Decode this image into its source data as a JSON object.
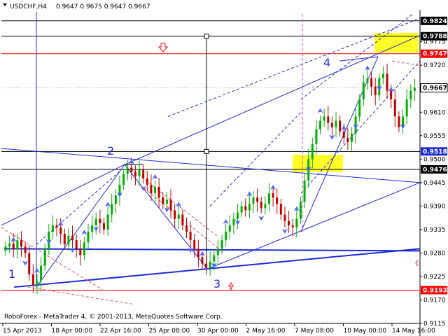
{
  "header": {
    "symbol_timeframe": "USDCHF,H4",
    "ohlc": "0.9647 0.9675 0.9647 0.9667"
  },
  "footer": {
    "copyright": "RoboForex - MetaTrader 4, © 2001-2013, MetaQuotes Software Corp."
  },
  "wave_labels": [
    "1",
    "2",
    "3",
    "4"
  ],
  "colors": {
    "up": "#00b000",
    "down": "#c00000",
    "wave_line": "#1f2bd6",
    "level_red": "#ff0000",
    "level_black": "#000000",
    "target_zone": "#ffff00",
    "fractal": "#4a64ff"
  },
  "chart_data": {
    "type": "candlestick",
    "symbol": "USDCHF",
    "timeframe": "H4",
    "ylim": [
      0.9115,
      0.9845
    ],
    "y_ticks": [
      0.9115,
      0.917,
      0.9225,
      0.928,
      0.9335,
      0.939,
      0.9445,
      0.95,
      0.9555,
      0.961,
      0.9665,
      0.972,
      0.9775
    ],
    "y_tick_labels": [
      "0.9115",
      "0.9170",
      "0.9225",
      "0.9280",
      "0.9335",
      "0.9390",
      "0.9445",
      "0.9500",
      "0.9555",
      "0.9610",
      "0.9665",
      "0.9720",
      "0.9775"
    ],
    "x_tick_labels": [
      "15 Apr 2013",
      "18 Apr 00:00",
      "22 Apr 16:00",
      "25 Apr 08:00",
      "30 Apr 00:00",
      "2 May 16:00",
      "7 May 08:00",
      "10 May 00:00",
      "14 May 16:00"
    ],
    "price_tags": [
      {
        "label": "0.9824",
        "value": 0.9824,
        "style": "black"
      },
      {
        "label": "0.9788",
        "value": 0.9788,
        "style": "black"
      },
      {
        "label": "0.9747",
        "value": 0.9747,
        "style": "red"
      },
      {
        "label": "0.9667",
        "value": 0.9667,
        "style": "current"
      },
      {
        "label": "0.9518",
        "value": 0.9518,
        "style": "blue"
      },
      {
        "label": "0.9476",
        "value": 0.9476,
        "style": "black"
      },
      {
        "label": "0.9193",
        "value": 0.9193,
        "style": "red"
      }
    ],
    "horizontal_levels": [
      {
        "value": 0.9824,
        "color": "#000000"
      },
      {
        "value": 0.9788,
        "color": "#000000"
      },
      {
        "value": 0.9747,
        "color": "#ff0000"
      },
      {
        "value": 0.9667,
        "color": "#999999",
        "dotted": true
      },
      {
        "value": 0.9518,
        "color": "#000000"
      },
      {
        "value": 0.9476,
        "color": "#000000"
      },
      {
        "value": 0.9193,
        "color": "#ff0000"
      }
    ],
    "closes": [
      0.9295,
      0.9302,
      0.9288,
      0.931,
      0.9295,
      0.928,
      0.923,
      0.9205,
      0.9215,
      0.925,
      0.929,
      0.933,
      0.9345,
      0.934,
      0.9325,
      0.93,
      0.932,
      0.931,
      0.929,
      0.9275,
      0.9305,
      0.933,
      0.9345,
      0.936,
      0.935,
      0.9335,
      0.937,
      0.9395,
      0.9415,
      0.944,
      0.9465,
      0.948,
      0.947,
      0.946,
      0.9475,
      0.9455,
      0.944,
      0.942,
      0.9435,
      0.941,
      0.9395,
      0.9405,
      0.938,
      0.936,
      0.937,
      0.9345,
      0.933,
      0.931,
      0.929,
      0.927,
      0.9255,
      0.9245,
      0.926,
      0.9275,
      0.929,
      0.931,
      0.933,
      0.9345,
      0.936,
      0.9375,
      0.939,
      0.938,
      0.9395,
      0.941,
      0.94,
      0.9385,
      0.9395,
      0.942,
      0.941,
      0.9395,
      0.937,
      0.9355,
      0.9345,
      0.934,
      0.936,
      0.94,
      0.945,
      0.95,
      0.9535,
      0.957,
      0.959,
      0.96,
      0.9585,
      0.9575,
      0.959,
      0.9565,
      0.955,
      0.954,
      0.956,
      0.96,
      0.964,
      0.968,
      0.969,
      0.967,
      0.965,
      0.969,
      0.97,
      0.966,
      0.964,
      0.96,
      0.9575,
      0.96,
      0.964,
      0.966,
      0.9667
    ],
    "candle_count": 105
  }
}
